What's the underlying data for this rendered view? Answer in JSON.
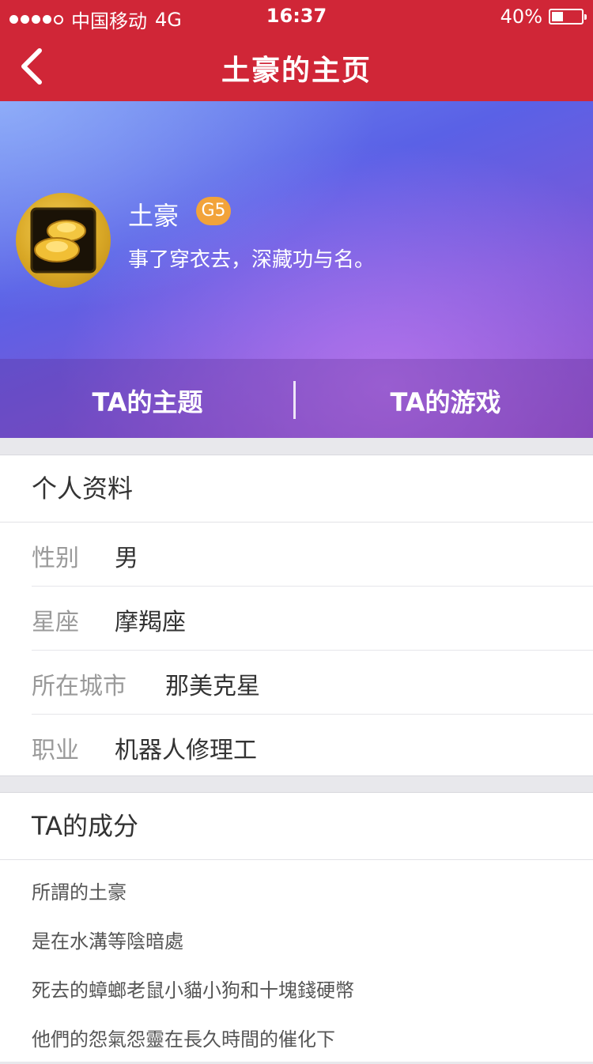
{
  "status_bar": {
    "carrier": "中国移动",
    "network": "4G",
    "time": "16:37",
    "battery_percent": "40%",
    "battery_level": 0.4,
    "signal_bars": 4,
    "signal_total": 5
  },
  "nav": {
    "title": "土豪的主页",
    "back_icon": "chevron-left-icon"
  },
  "profile": {
    "username": "土豪",
    "level": "G5",
    "signature": "事了穿衣去，深藏功与名。",
    "avatar_icon": "gold-ingot-avatar"
  },
  "tabs": [
    {
      "label": "TA的主题"
    },
    {
      "label": "TA的游戏"
    }
  ],
  "personal_info": {
    "title": "个人资料",
    "rows": [
      {
        "label": "性别",
        "value": "男"
      },
      {
        "label": "星座",
        "value": "摩羯座"
      },
      {
        "label": "所在城市",
        "value": "那美克星"
      },
      {
        "label": "职业",
        "value": "机器人修理工"
      }
    ]
  },
  "composition": {
    "title": "TA的成分",
    "lines": [
      "所謂的土豪",
      "是在水溝等陰暗處",
      "死去的蟑螂老鼠小貓小狗和十塊錢硬幣",
      "他們的怨氣怨靈在長久時間的催化下"
    ]
  },
  "colors": {
    "brand_red": "#d02637",
    "badge_orange": "#f2a33a",
    "hero_purple": "#6a5ae0"
  }
}
